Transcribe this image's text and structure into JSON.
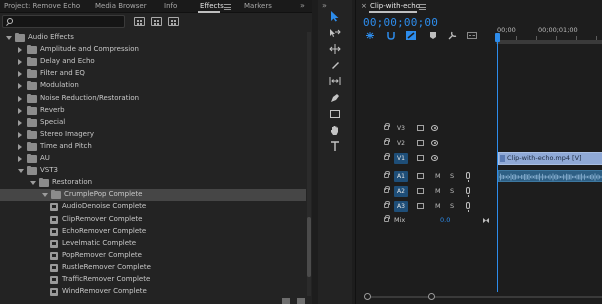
{
  "panel_tabs": {
    "project": "Project: Remove Echo",
    "media_browser": "Media Browser",
    "info": "Info",
    "effects": "Effects",
    "markers": "Markers",
    "overflow": "»"
  },
  "search": {
    "value": "",
    "placeholder": ""
  },
  "tree": [
    {
      "label": "Audio Effects",
      "level": 0,
      "expanded": true,
      "type": "folder"
    },
    {
      "label": "Amplitude and Compression",
      "level": 1,
      "expanded": false,
      "type": "folder"
    },
    {
      "label": "Delay and Echo",
      "level": 1,
      "expanded": false,
      "type": "folder"
    },
    {
      "label": "Filter and EQ",
      "level": 1,
      "expanded": false,
      "type": "folder"
    },
    {
      "label": "Modulation",
      "level": 1,
      "expanded": false,
      "type": "folder"
    },
    {
      "label": "Noise Reduction/Restoration",
      "level": 1,
      "expanded": false,
      "type": "folder"
    },
    {
      "label": "Reverb",
      "level": 1,
      "expanded": false,
      "type": "folder"
    },
    {
      "label": "Special",
      "level": 1,
      "expanded": false,
      "type": "folder"
    },
    {
      "label": "Stereo Imagery",
      "level": 1,
      "expanded": false,
      "type": "folder"
    },
    {
      "label": "Time and Pitch",
      "level": 1,
      "expanded": false,
      "type": "folder"
    },
    {
      "label": "AU",
      "level": 1,
      "expanded": false,
      "type": "folder"
    },
    {
      "label": "VST3",
      "level": 1,
      "expanded": true,
      "type": "folder"
    },
    {
      "label": "Restoration",
      "level": 2,
      "expanded": true,
      "type": "folder"
    },
    {
      "label": "CrumplePop Complete",
      "level": 3,
      "expanded": true,
      "type": "folder",
      "selected": true
    },
    {
      "label": "AudioDenoise Complete",
      "level": 4,
      "type": "effect"
    },
    {
      "label": "ClipRemover Complete",
      "level": 4,
      "type": "effect"
    },
    {
      "label": "EchoRemover Complete",
      "level": 4,
      "type": "effect"
    },
    {
      "label": "Levelmatic Complete",
      "level": 4,
      "type": "effect"
    },
    {
      "label": "PopRemover Complete",
      "level": 4,
      "type": "effect"
    },
    {
      "label": "RustleRemover Complete",
      "level": 4,
      "type": "effect"
    },
    {
      "label": "TrafficRemover Complete",
      "level": 4,
      "type": "effect"
    },
    {
      "label": "WindRemover Complete",
      "level": 4,
      "type": "effect"
    }
  ],
  "toolbar": {
    "overflow": "»",
    "tools": [
      "selection-tool",
      "track-select-tool",
      "ripple-edit-tool",
      "razor-tool",
      "slip-tool",
      "pen-tool",
      "rectangle-tool",
      "hand-tool",
      "type-tool"
    ]
  },
  "timeline": {
    "close": "×",
    "title": "Clip-with-echo",
    "timecode": "00;00;00;00",
    "ruler": [
      "00;00",
      "00;00;01;00"
    ],
    "tracks": [
      {
        "name": "V3",
        "kind": "video",
        "target": false
      },
      {
        "name": "V2",
        "kind": "video",
        "target": false
      },
      {
        "name": "V1",
        "kind": "video",
        "target": true
      },
      {
        "name": "A1",
        "kind": "audio",
        "target": true,
        "m": "M",
        "s": "S"
      },
      {
        "name": "A2",
        "kind": "audio",
        "target": true,
        "m": "M",
        "s": "S"
      },
      {
        "name": "A3",
        "kind": "audio",
        "target": true,
        "m": "M",
        "s": "S"
      }
    ],
    "mix": {
      "name": "Mix",
      "value": "0.0"
    },
    "video_clip": "Clip-with-echo.mp4 [V]"
  },
  "colors": {
    "accent": "#2d8ceb",
    "video_clip": "#8fa9d6",
    "audio_clip": "#2e5f84",
    "selected_row": "#464646"
  }
}
